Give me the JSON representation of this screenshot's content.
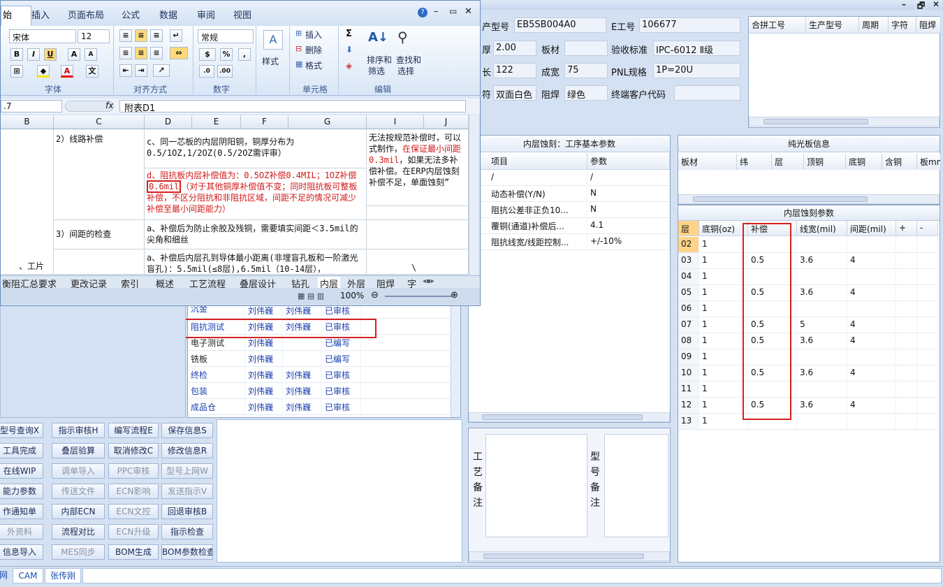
{
  "app_titlebar": {
    "minimize": "–",
    "restore": "🗗",
    "close": "✕"
  },
  "header": {
    "product_model_label": "产型号",
    "product_model": "EB5SB004A0",
    "eng_no_label": "E工号",
    "eng_no": "106677",
    "thickness_label": "厚",
    "thickness": "2.00",
    "board_label": "板材",
    "board": "",
    "accept_label": "验收标准",
    "accept": "IPC-6012 Ⅱ级",
    "length_label": "长",
    "length": "122",
    "width_label": "成宽",
    "width": "75",
    "pnl_label": "PNL规格",
    "pnl": "1P=20U",
    "char_label": "符",
    "char": "双面白色",
    "mask_label": "阻焊",
    "mask": "绿色",
    "customer_label": "终端客户代码",
    "customer": ""
  },
  "merge_table": {
    "headers": [
      "合拼工号",
      "生产型号",
      "周期",
      "字符",
      "阻焊"
    ]
  },
  "inner_etch": {
    "title": "内层蚀刻：工序基本参数",
    "headers": [
      "项目",
      "参数"
    ],
    "rows": [
      [
        "/",
        "/"
      ],
      [
        "动态补偿(Y/N)",
        "N"
      ],
      [
        "阻抗公差非正负10...",
        "N"
      ],
      [
        "覆铜(通道)补偿后...",
        "4.1"
      ],
      [
        "阻抗线宽/线距控制...",
        "+/-10%"
      ]
    ]
  },
  "bare_board": {
    "title": "纯光板信息",
    "headers": [
      "板材",
      "纬",
      "层",
      "顶铜",
      "底铜",
      "含铜",
      "板mm"
    ]
  },
  "inner_params": {
    "title": "内层蚀刻参数",
    "headers": [
      "层",
      "底铜(oz)",
      "补偿",
      "线宽(mil)",
      "间距(mil)",
      "+",
      "-"
    ],
    "rows": [
      [
        "02",
        "1",
        "",
        "",
        ""
      ],
      [
        "03",
        "1",
        "0.5",
        "3.6",
        "4"
      ],
      [
        "04",
        "1",
        "",
        "",
        ""
      ],
      [
        "05",
        "1",
        "0.5",
        "3.6",
        "4"
      ],
      [
        "06",
        "1",
        "",
        "",
        ""
      ],
      [
        "07",
        "1",
        "0.5",
        "5",
        "4"
      ],
      [
        "08",
        "1",
        "0.5",
        "3.6",
        "4"
      ],
      [
        "09",
        "1",
        "",
        "",
        ""
      ],
      [
        "10",
        "1",
        "0.5",
        "3.6",
        "4"
      ],
      [
        "11",
        "1",
        "",
        "",
        ""
      ],
      [
        "12",
        "1",
        "0.5",
        "3.6",
        "4"
      ],
      [
        "13",
        "1",
        "",
        "",
        ""
      ]
    ]
  },
  "remarks": {
    "process": "工艺备注",
    "model": "型号备注"
  },
  "process_list": {
    "rows": [
      [
        "沉金",
        "刘伟巍",
        "刘伟巍",
        "已审核"
      ],
      [
        "阻抗测试",
        "刘伟巍",
        "刘伟巍",
        "已审核"
      ],
      [
        "电子测试",
        "刘伟巍",
        "",
        "已编写"
      ],
      [
        "铣板",
        "刘伟巍",
        "",
        "已编写"
      ],
      [
        "终检",
        "刘伟巍",
        "刘伟巍",
        "已审核"
      ],
      [
        "包装",
        "刘伟巍",
        "刘伟巍",
        "已审核"
      ],
      [
        "成品仓",
        "刘伟巍",
        "刘伟巍",
        "已审核"
      ]
    ]
  },
  "buttons": [
    [
      "型号查询X",
      "指示审核H",
      "编写流程E",
      "保存信息S"
    ],
    [
      "工具完成",
      "叠层验算",
      "取消修改C",
      "修改信息R"
    ],
    [
      "在线WIP",
      "调单导入",
      "PPC审核",
      "型号上网W"
    ],
    [
      "能力参数",
      "传送文件",
      "ECN影响",
      "发送指示V"
    ],
    [
      "作通知单",
      "内部ECN",
      "ECN文控",
      "回退审核B"
    ],
    [
      "外资料",
      "流程对比",
      "ECN升级",
      "指示检查"
    ],
    [
      "信息导入",
      "MES同步",
      "BOM生成",
      "BOM参数检查"
    ]
  ],
  "statusbar": {
    "a": "网",
    "b": "CAM",
    "c": "张传刚"
  },
  "excel": {
    "tabs": [
      "始",
      "插入",
      "页面布局",
      "公式",
      "数据",
      "审阅",
      "视图"
    ],
    "font_name": "宋体",
    "font_size": "12",
    "number_format": "常规",
    "groups": {
      "font": "字体",
      "align": "对齐方式",
      "number": "数字",
      "cells": "单元格",
      "edit": "编辑"
    },
    "style_btn": "样式",
    "cell_btns": [
      "插入",
      "删除",
      "格式"
    ],
    "edit_btns": {
      "sort": "排序和",
      "sort2": "筛选",
      "find": "查找和",
      "find2": "选择"
    },
    "name_box": ".7",
    "fx": "fx",
    "formula": "附表D1",
    "cols": [
      "B",
      "C",
      "D",
      "E",
      "F",
      "G",
      "I",
      "J"
    ],
    "c1": "2）线路补偿",
    "d1": "c、同一芯板的内层阴阳铜，铜厚分布为0.5/1OZ,1/2OZ(0.5/2OZ需评审）",
    "d2_red": "d、阻抗板内层补偿值为：0.5OZ补偿0.4MIL；1OZ补偿",
    "d2_box": "0.6mil",
    "d2_rest": "（对于其他铜厚补偿值不变；同时阻抗板可整板补偿，不区分阻抗和非阻抗区域，间距不足的情况可减少补偿至最小间距能力）",
    "i1a": "无法按规范补偿时，可以式制作，",
    "i1b": "在保证最小间距0.3mil",
    "i1c": "，如果无法多补偿补偿。在ERP内层蚀刻补偿不足，单面蚀刻”",
    "c2": "3）间距的检查",
    "d3": "a、补偿后为防止余胶及残铜，需要填实间距＜3.5mil的尖角和细丝",
    "d4": "a、补偿后内层孔到导体最小距离(非埋盲孔板和一阶激光盲孔)：5.5mil(≤8层),6.5mil（10-14层），",
    "backslash": "\\",
    "b_partial": "、工片",
    "sheet_tabs": [
      "衡阻汇总要求",
      "更改记录",
      "索引",
      "概述",
      "工艺流程",
      "叠层设计",
      "钻孔",
      "内层",
      "外层",
      "阻焊",
      "字"
    ],
    "zoom": "100%"
  }
}
